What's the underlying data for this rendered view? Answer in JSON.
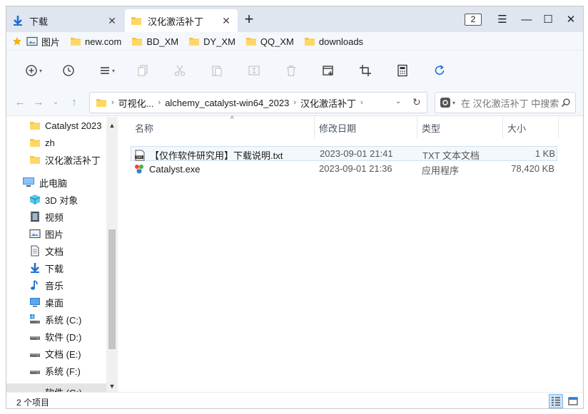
{
  "tabs": [
    {
      "label": "下载",
      "active": false
    },
    {
      "label": "汉化激活补丁",
      "active": true
    }
  ],
  "tab_count": "2",
  "bookmarks": [
    {
      "label": "图片",
      "icon": "pictures-icon"
    },
    {
      "label": "new.com",
      "icon": "folder-icon"
    },
    {
      "label": "BD_XM",
      "icon": "folder-icon"
    },
    {
      "label": "DY_XM",
      "icon": "folder-icon"
    },
    {
      "label": "QQ_XM",
      "icon": "folder-icon"
    },
    {
      "label": "downloads",
      "icon": "folder-icon"
    }
  ],
  "breadcrumb": [
    "可视化...",
    "alchemy_catalyst-win64_2023",
    "汉化激活补丁"
  ],
  "search": {
    "placeholder": "在 汉化激活补丁 中搜索"
  },
  "sidebar": {
    "items": [
      {
        "label": "Catalyst 2023",
        "icon": "folder-icon"
      },
      {
        "label": "zh",
        "icon": "folder-icon"
      },
      {
        "label": "汉化激活补丁",
        "icon": "folder-icon"
      },
      {
        "label": "此电脑",
        "icon": "this-pc-icon"
      },
      {
        "label": "3D 对象",
        "icon": "3d-objects-icon"
      },
      {
        "label": "视频",
        "icon": "videos-icon"
      },
      {
        "label": "图片",
        "icon": "pictures-icon"
      },
      {
        "label": "文档",
        "icon": "documents-icon"
      },
      {
        "label": "下载",
        "icon": "downloads-icon"
      },
      {
        "label": "音乐",
        "icon": "music-icon"
      },
      {
        "label": "桌面",
        "icon": "desktop-icon"
      },
      {
        "label": "系统 (C:)",
        "icon": "system-drive-icon"
      },
      {
        "label": "软件 (D:)",
        "icon": "drive-icon"
      },
      {
        "label": "文档 (E:)",
        "icon": "drive-icon"
      },
      {
        "label": "系统 (F:)",
        "icon": "drive-icon"
      },
      {
        "label": "软件 (G:)",
        "icon": "drive-icon"
      }
    ]
  },
  "columns": {
    "name": "名称",
    "date": "修改日期",
    "type": "类型",
    "size": "大小"
  },
  "files": [
    {
      "name": "【仅作软件研究用】下载说明.txt",
      "date": "2023-09-01 21:41",
      "type": "TXT 文本文档",
      "size": "1 KB",
      "icon": "txt-file-icon"
    },
    {
      "name": "Catalyst.exe",
      "date": "2023-09-01 21:36",
      "type": "应用程序",
      "size": "78,420 KB",
      "icon": "exe-file-icon"
    }
  ],
  "status": {
    "count": "2 个项目"
  },
  "colors": {
    "accent": "#1f6fd1",
    "folder": "#f5c342",
    "tabbar": "#dfe6ef"
  }
}
